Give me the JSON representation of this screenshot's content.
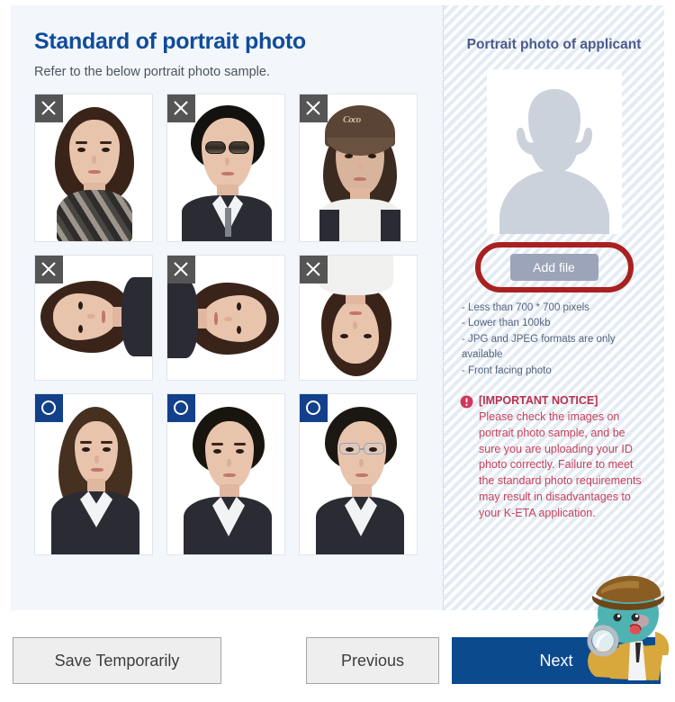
{
  "page": {
    "title": "Standard of portrait photo",
    "subtitle": "Refer to the below portrait photo sample."
  },
  "samples": {
    "bad_badge_icon": "x-mark-icon",
    "good_badge_icon": "circle-mark-icon",
    "items": [
      {
        "status": "bad",
        "label": "Covered neck and chin with scarf"
      },
      {
        "status": "bad",
        "label": "Wearing sunglasses"
      },
      {
        "status": "bad",
        "label": "Wearing a hat or cap"
      },
      {
        "status": "bad",
        "label": "Photo rotated 90 degrees left"
      },
      {
        "status": "bad",
        "label": "Photo rotated 90 degrees right"
      },
      {
        "status": "bad",
        "label": "Photo upside down"
      },
      {
        "status": "good",
        "label": "Correct front facing photo"
      },
      {
        "status": "good",
        "label": "Correct front facing photo"
      },
      {
        "status": "good",
        "label": "Correct front facing photo with glasses"
      }
    ]
  },
  "upload": {
    "title": "Portrait photo of applicant",
    "avatar_icon": "person-placeholder-icon",
    "add_file_label": "Add file",
    "highlight_color": "#a92020",
    "requirements": [
      "Less than 700 * 700 pixels",
      "Lower than 100kb",
      "JPG and JPEG formats are only available",
      "Front facing photo"
    ],
    "notice": {
      "icon": "exclamation-circle-icon",
      "heading": "[IMPORTANT NOTICE]",
      "text": "Please check the images on portrait photo sample, and be sure you are uploading your ID photo correctly. Failure to meet the standard photo requirements may result in disadvantages to your K-ETA application.",
      "color": "#c8405a"
    }
  },
  "footer": {
    "save_label": "Save Temporarily",
    "previous_label": "Previous",
    "next_label": "Next",
    "primary_color": "#0c4a8e"
  },
  "mascot": {
    "name": "detective-mascot-watermark"
  }
}
